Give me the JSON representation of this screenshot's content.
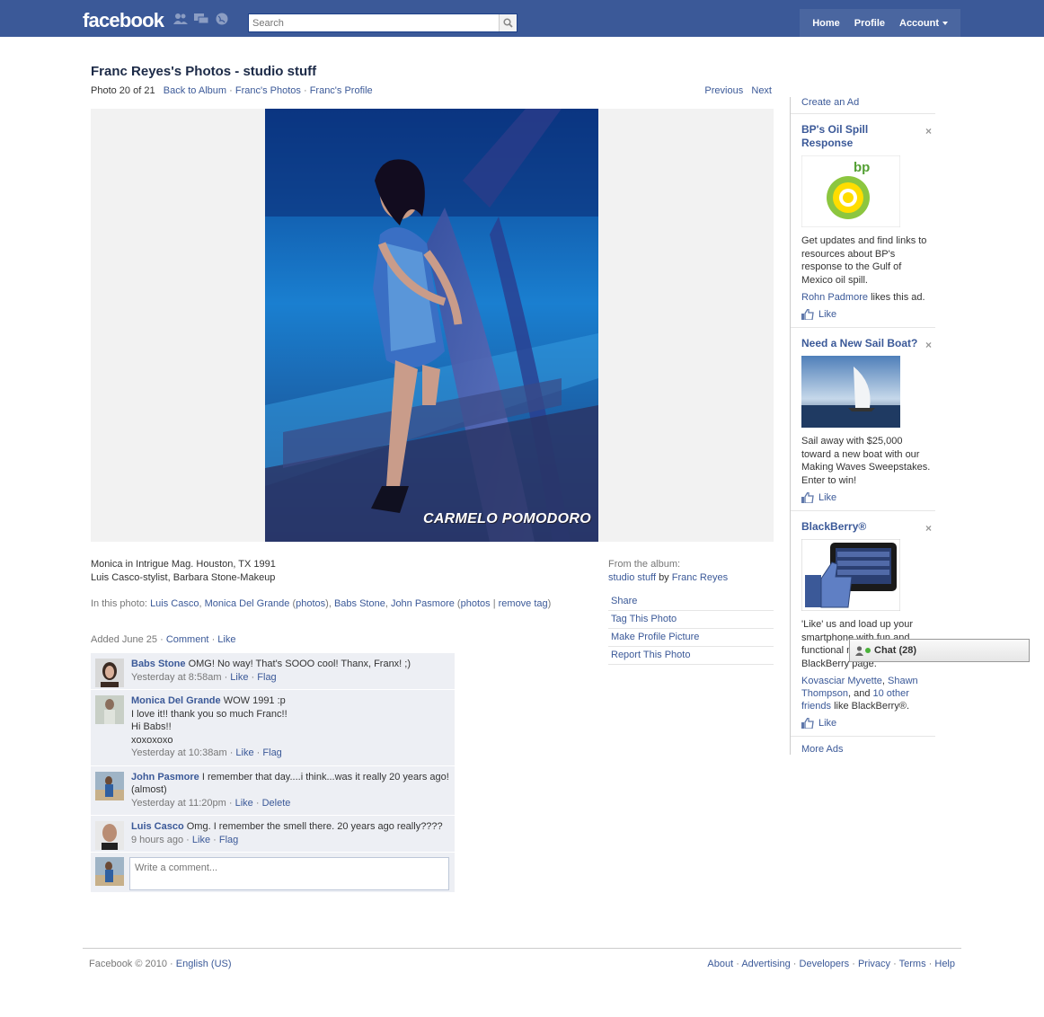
{
  "topbar": {
    "logo": "facebook",
    "search_placeholder": "Search",
    "nav": {
      "home": "Home",
      "profile": "Profile",
      "account": "Account"
    }
  },
  "header": {
    "title": "Franc Reyes's Photos - studio stuff",
    "photo_count": "Photo 20 of 21",
    "back_to_album": "Back to Album",
    "francs_photos": "Franc's Photos",
    "francs_profile": "Franc's Profile",
    "previous": "Previous",
    "next": "Next"
  },
  "photo": {
    "watermark": "CARMELO POMODORO"
  },
  "caption": {
    "line1": "Monica in Intrigue Mag. Houston, TX 1991",
    "line2": "Luis Casco-stylist, Barbara Stone-Makeup"
  },
  "tags": {
    "prefix": "In this photo:",
    "luis": "Luis Casco",
    "monica": "Monica Del Grande",
    "photos1": "photos",
    "babs": "Babs Stone",
    "john": "John Pasmore",
    "photos2": "photos",
    "remove": "remove",
    "tag": "tag"
  },
  "added": {
    "text": "Added June 25",
    "comment": "Comment",
    "like": "Like"
  },
  "album": {
    "from_label": "From the album:",
    "album_name": "studio stuff",
    "by": "by",
    "owner": "Franc Reyes"
  },
  "actions": {
    "share": "Share",
    "tag": "Tag This Photo",
    "profile_pic": "Make Profile Picture",
    "report": "Report This Photo"
  },
  "comments": [
    {
      "author": "Babs Stone",
      "text": "OMG! No way! That's SOOO cool! Thanx, Franx! ;)",
      "time": "Yesterday at 8:58am",
      "a1": "Like",
      "a2": "Flag"
    },
    {
      "author": "Monica Del Grande",
      "text": "WOW 1991 :p",
      "line2": "I love it!! thank you so much Franc!!",
      "line3": "Hi Babs!!",
      "line4": "xoxoxoxo",
      "time": "Yesterday at 10:38am",
      "a1": "Like",
      "a2": "Flag"
    },
    {
      "author": "John Pasmore",
      "text": "I remember that day....i think...was it really 20 years ago! (almost)",
      "time": "Yesterday at 11:20pm",
      "a1": "Like",
      "a2": "Delete"
    },
    {
      "author": "Luis Casco",
      "text": "Omg. I remember the smell there. 20 years ago really????",
      "time": "9 hours ago",
      "a1": "Like",
      "a2": "Flag"
    }
  ],
  "comment_form": {
    "placeholder": "Write a comment..."
  },
  "ads": {
    "create": "Create an Ad",
    "items": [
      {
        "title": "BP's Oil Spill Response",
        "text": "Get updates and find links to resources about BP's response to the Gulf of Mexico oil spill.",
        "social_name": "Rohn Padmore",
        "social_rest": "likes this ad.",
        "like": "Like",
        "img_text": "bp"
      },
      {
        "title": "Need a New Sail Boat?",
        "text": "Sail away with $25,000 toward a new boat with our Making Waves Sweepstakes. Enter to win!",
        "like": "Like"
      },
      {
        "title": "BlackBerry®",
        "text": "'Like' us and load up your smartphone with fun and functional new apps from the BlackBerry page.",
        "social_name1": "Kovasciar Myvette",
        "social_name2": "Shawn Thompson",
        "social_and": ", and",
        "social_others": "10 other friends",
        "social_rest": "like BlackBerry®.",
        "like": "Like"
      }
    ],
    "more": "More Ads"
  },
  "chat": {
    "label": "Chat",
    "count": "(28)"
  },
  "footer": {
    "copyright": "Facebook © 2010 ·",
    "language": "English (US)",
    "links": [
      "About",
      "Advertising",
      "Developers",
      "Privacy",
      "Terms",
      "Help"
    ]
  },
  "colors": {
    "brand": "#3b5998",
    "comment_bg": "#edeff4"
  }
}
